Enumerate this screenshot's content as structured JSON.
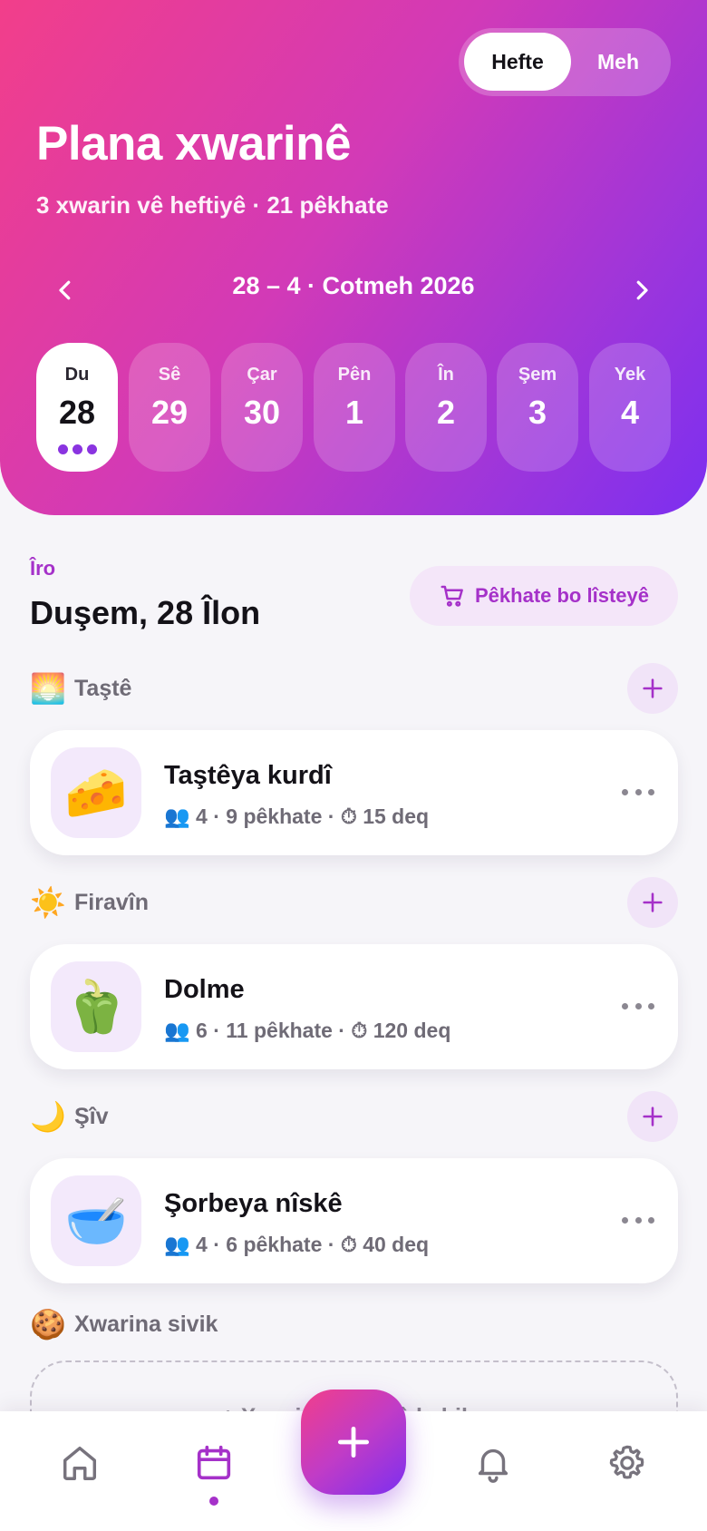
{
  "header": {
    "view_toggle": {
      "week": "Hefte",
      "month": "Meh"
    },
    "title": "Plana xwarinê",
    "subtitle": "3 xwarin vê heftiyê · 21 pêkhate",
    "week_range": "28 – 4 · Cotmeh 2026",
    "days": [
      {
        "name": "Du",
        "num": "28",
        "selected": true
      },
      {
        "name": "Sê",
        "num": "29",
        "selected": false
      },
      {
        "name": "Çar",
        "num": "30",
        "selected": false
      },
      {
        "name": "Pên",
        "num": "1",
        "selected": false
      },
      {
        "name": "În",
        "num": "2",
        "selected": false
      },
      {
        "name": "Şem",
        "num": "3",
        "selected": false
      },
      {
        "name": "Yek",
        "num": "4",
        "selected": false
      }
    ]
  },
  "today": {
    "tag": "Îro",
    "date": "Duşem, 28 Îlon",
    "shop_button": "Pêkhate bo lîsteyê"
  },
  "meals": [
    {
      "section": "Taştê",
      "section_emoji": "🌅",
      "name": "Taştêya kurdî",
      "emoji": "🧀",
      "people": "4",
      "ingredients": "9 pêkhate",
      "time": "15 deq"
    },
    {
      "section": "Firavîn",
      "section_emoji": "☀️",
      "name": "Dolme",
      "emoji": "🫑",
      "people": "6",
      "ingredients": "11 pêkhate",
      "time": "120 deq"
    },
    {
      "section": "Şîv",
      "section_emoji": "🌙",
      "name": "Şorbeya nîskê",
      "emoji": "🥣",
      "people": "4",
      "ingredients": "6 pêkhate",
      "time": "40 deq"
    }
  ],
  "snacks": {
    "section": "Xwarina sivik",
    "section_emoji": "🍪",
    "placeholder": "+ Xwarinekê lê zêde bike"
  },
  "icons": {
    "people": "👥",
    "timer": "⏱"
  },
  "tabbar": [
    "home-icon",
    "calendar-icon",
    "plus-icon",
    "bell-icon",
    "settings-icon"
  ],
  "colors": {
    "accent": "#a531c9",
    "gradient_start": "#f23e8a",
    "gradient_end": "#7c2ff0"
  }
}
